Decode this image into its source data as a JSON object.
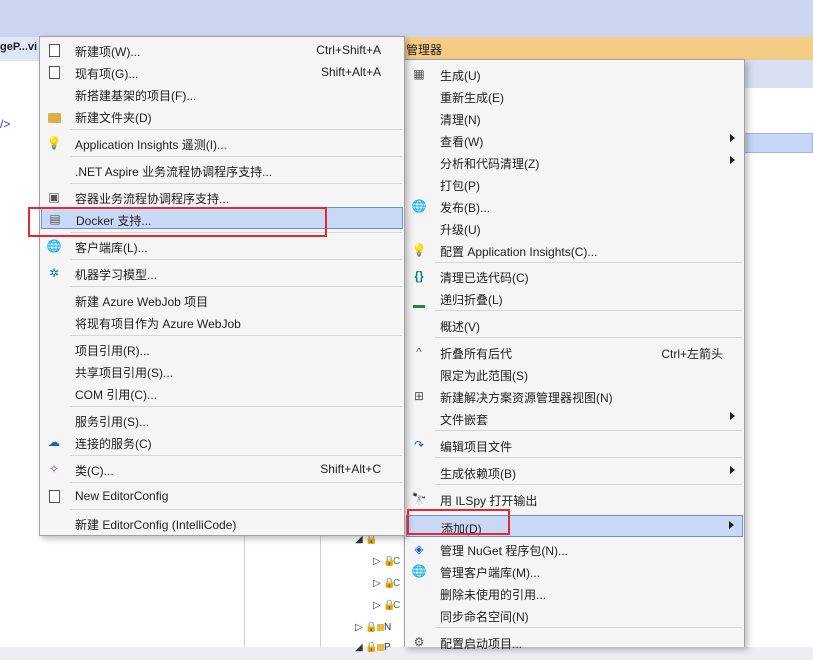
{
  "window": {
    "doc_tab_label": "geP...vi",
    "editor_snippet": "/>",
    "solution_explorer_title": "管理器"
  },
  "add_submenu": {
    "items": [
      {
        "label": "新建项(W)...",
        "shortcut": "Ctrl+Shift+A",
        "icon": "new-item-icon"
      },
      {
        "label": "现有项(G)...",
        "shortcut": "Shift+Alt+A",
        "icon": "existing-item-icon"
      },
      {
        "label": "新搭建基架的项目(F)...",
        "shortcut": "",
        "icon": ""
      },
      {
        "label": "新建文件夹(D)",
        "shortcut": "",
        "icon": "new-folder-icon"
      },
      {
        "label": "Application Insights 遥测(I)...",
        "shortcut": "",
        "icon": "application-insights-icon"
      },
      {
        "label": ".NET Aspire 业务流程协调程序支持...",
        "shortcut": "",
        "icon": ""
      },
      {
        "label": "容器业务流程协调程序支持...",
        "shortcut": "",
        "icon": "container-orchestrator-icon"
      },
      {
        "label": "Docker 支持...",
        "shortcut": "",
        "icon": "docker-support-icon"
      },
      {
        "label": "客户端库(L)...",
        "shortcut": "",
        "icon": "client-library-icon"
      },
      {
        "label": "机器学习模型...",
        "shortcut": "",
        "icon": "machine-learning-icon"
      },
      {
        "label": "新建 Azure WebJob 项目",
        "shortcut": "",
        "icon": ""
      },
      {
        "label": "将现有项目作为 Azure WebJob",
        "shortcut": "",
        "icon": ""
      },
      {
        "label": "项目引用(R)...",
        "shortcut": "",
        "icon": ""
      },
      {
        "label": "共享项目引用(S)...",
        "shortcut": "",
        "icon": ""
      },
      {
        "label": "COM 引用(C)...",
        "shortcut": "",
        "icon": ""
      },
      {
        "label": "服务引用(S)...",
        "shortcut": "",
        "icon": ""
      },
      {
        "label": "连接的服务(C)",
        "shortcut": "",
        "icon": "connected-services-icon"
      },
      {
        "label": "类(C)...",
        "shortcut": "Shift+Alt+C",
        "icon": "class-icon"
      },
      {
        "label": "New EditorConfig",
        "shortcut": "",
        "icon": "editorconfig-icon"
      },
      {
        "label": "新建 EditorConfig (IntelliCode)",
        "shortcut": "",
        "icon": ""
      }
    ]
  },
  "context_menu": {
    "items": [
      {
        "label": "生成(U)",
        "shortcut": "",
        "icon": "build-icon"
      },
      {
        "label": "重新生成(E)",
        "shortcut": "",
        "icon": ""
      },
      {
        "label": "清理(N)",
        "shortcut": "",
        "icon": ""
      },
      {
        "label": "查看(W)",
        "shortcut": "",
        "icon": ""
      },
      {
        "label": "分析和代码清理(Z)",
        "shortcut": "",
        "icon": ""
      },
      {
        "label": "打包(P)",
        "shortcut": "",
        "icon": ""
      },
      {
        "label": "发布(B)...",
        "shortcut": "",
        "icon": "publish-globe-icon"
      },
      {
        "label": "升级(U)",
        "shortcut": "",
        "icon": ""
      },
      {
        "label": "配置 Application Insights(C)...",
        "shortcut": "",
        "icon": "application-insights-icon"
      },
      {
        "label": "清理已选代码(C)",
        "shortcut": "",
        "icon": "braces-icon"
      },
      {
        "label": "递归折叠(L)",
        "shortcut": "",
        "icon": "collapse-bar-icon"
      },
      {
        "label": "概述(V)",
        "shortcut": "",
        "icon": ""
      },
      {
        "label": "折叠所有后代",
        "shortcut": "Ctrl+左箭头",
        "icon": "caret-up-icon"
      },
      {
        "label": "限定为此范围(S)",
        "shortcut": "",
        "icon": ""
      },
      {
        "label": "新建解决方案资源管理器视图(N)",
        "shortcut": "",
        "icon": "new-view-icon"
      },
      {
        "label": "文件嵌套",
        "shortcut": "",
        "icon": ""
      },
      {
        "label": "编辑项目文件",
        "shortcut": "",
        "icon": "redo-arrow-icon"
      },
      {
        "label": "生成依赖项(B)",
        "shortcut": "",
        "icon": ""
      },
      {
        "label": "用 ILSpy 打开输出",
        "shortcut": "",
        "icon": "ilspy-icon"
      },
      {
        "label": "添加(D)",
        "shortcut": "",
        "icon": ""
      },
      {
        "label": "管理 NuGet 程序包(N)...",
        "shortcut": "",
        "icon": "nuget-icon"
      },
      {
        "label": "管理客户端库(M)...",
        "shortcut": "",
        "icon": "client-library-icon"
      },
      {
        "label": "删除未使用的引用...",
        "shortcut": "",
        "icon": ""
      },
      {
        "label": "同步命名空间(N)",
        "shortcut": "",
        "icon": ""
      },
      {
        "label": "配置启动项目...",
        "shortcut": "",
        "icon": "gear-icon"
      }
    ]
  },
  "tree_rows": [
    "C",
    "C",
    "C",
    "N",
    "P"
  ]
}
